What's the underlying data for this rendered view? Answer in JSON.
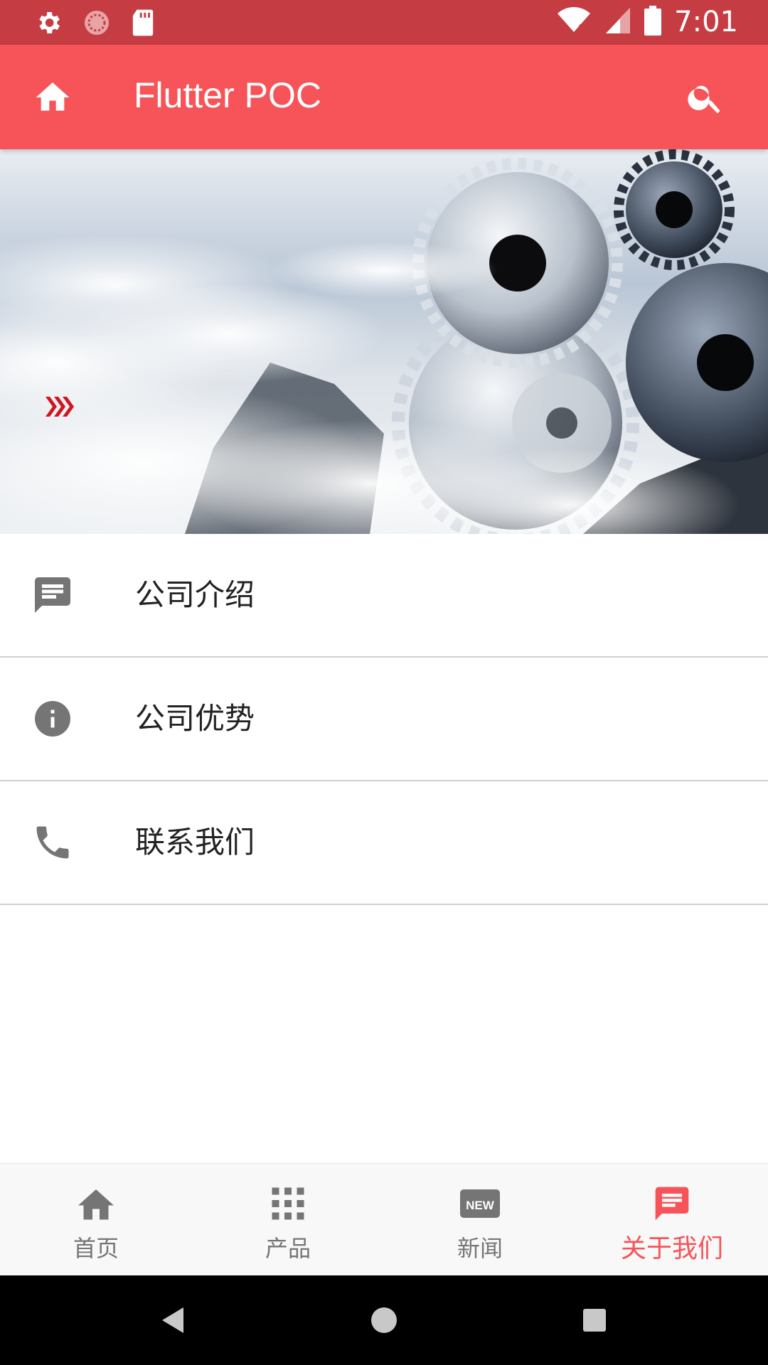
{
  "status_bar": {
    "time": "7:01",
    "icons": [
      "settings-icon",
      "sync-icon",
      "sd-card-icon",
      "wifi-icon",
      "signal-icon",
      "battery-icon"
    ]
  },
  "app_bar": {
    "title": "Flutter POC",
    "home_icon": "home-icon",
    "search_icon": "search-icon",
    "color": "#f65458"
  },
  "menu": {
    "items": [
      {
        "label": "公司介绍",
        "icon": "message-icon"
      },
      {
        "label": "公司优势",
        "icon": "info-icon"
      },
      {
        "label": "联系我们",
        "icon": "phone-icon"
      }
    ]
  },
  "bottom_nav": {
    "items": [
      {
        "label": "首页",
        "icon": "home-icon"
      },
      {
        "label": "产品",
        "icon": "apps-grid-icon"
      },
      {
        "label": "新闻",
        "icon": "new-badge-icon"
      },
      {
        "label": "关于我们",
        "icon": "chat-icon"
      }
    ],
    "active_index": 3,
    "active_color": "#f65458",
    "inactive_color": "#757575"
  },
  "system_nav": {
    "icons": [
      "back-icon",
      "home-circle-icon",
      "recents-icon"
    ]
  }
}
